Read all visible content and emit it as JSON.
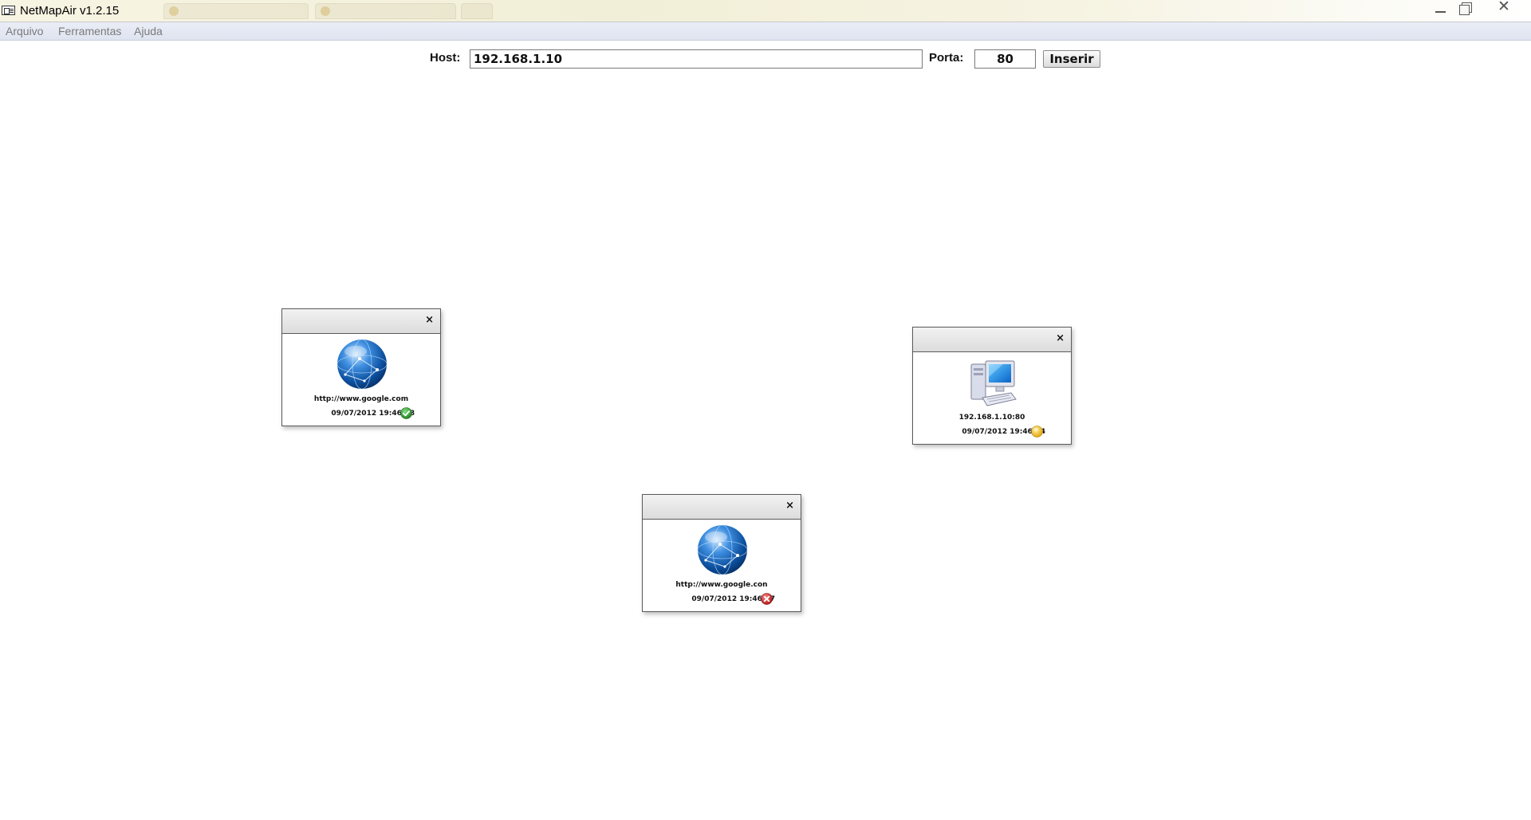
{
  "window": {
    "title": "NetMapAir v1.2.15",
    "controls": {
      "minimize": "minimize-icon",
      "maximize": "restore-icon",
      "close": "close-icon"
    }
  },
  "menu": {
    "items": [
      {
        "label": "Arquivo"
      },
      {
        "label": "Ferramentas"
      },
      {
        "label": "Ajuda"
      }
    ]
  },
  "host_bar": {
    "host_label": "Host:",
    "host_value": "192.168.1.10",
    "port_label": "Porta:",
    "port_value": "80",
    "insert_label": "Inserir"
  },
  "nodes": [
    {
      "target": "http://www.google.com",
      "timestamp": "09/07/2012 19:46:08",
      "icon": "globe-icon",
      "status": "ok",
      "status_icon": "check-circle-icon",
      "status_color": "#2e9a2e",
      "close_label": "×"
    },
    {
      "target": "192.168.1.10:80",
      "timestamp": "09/07/2012 19:46:04",
      "icon": "computer-icon",
      "status": "pending",
      "status_icon": "yellow-circle-icon",
      "status_color": "#f0b400",
      "close_label": "×"
    },
    {
      "target": "http://www.google.con",
      "timestamp": "09/07/2012 19:46:07",
      "icon": "globe-icon",
      "status": "error",
      "status_icon": "x-circle-icon",
      "status_color": "#cc2222",
      "close_label": "×"
    }
  ]
}
